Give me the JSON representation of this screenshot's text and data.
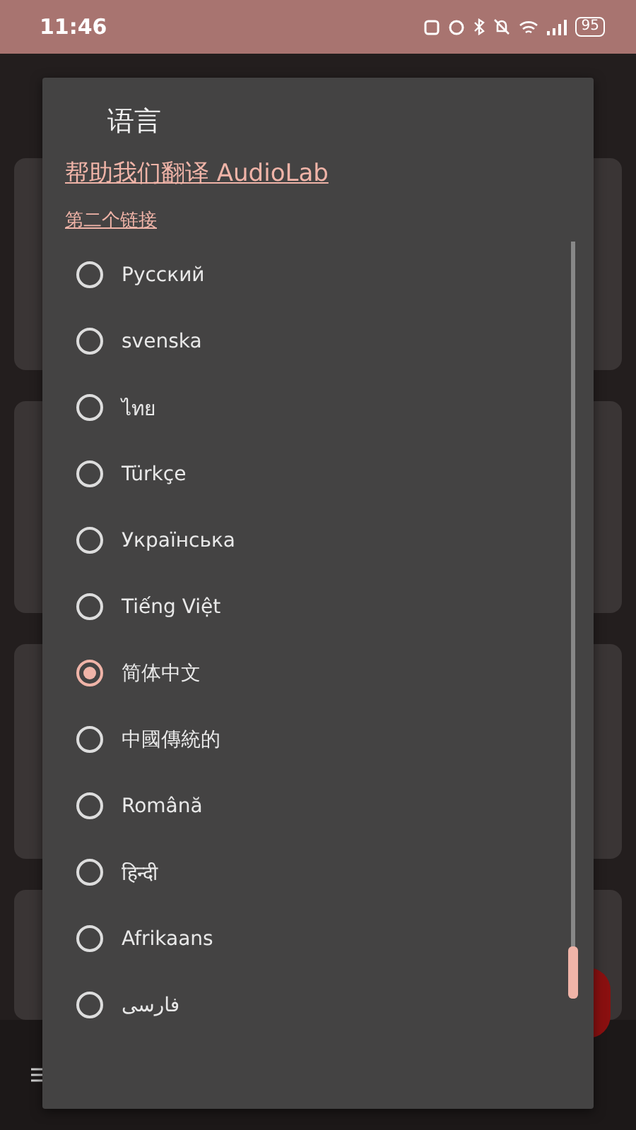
{
  "status_bar": {
    "time": "11:46",
    "battery": "95"
  },
  "dialog": {
    "title": "语言",
    "links": [
      "帮助我们翻译 AudioLab",
      "第二个链接"
    ],
    "options": [
      {
        "label": "Русский",
        "selected": false
      },
      {
        "label": "svenska",
        "selected": false
      },
      {
        "label": "ไทย",
        "selected": false
      },
      {
        "label": "Türkçe",
        "selected": false
      },
      {
        "label": "Українська",
        "selected": false
      },
      {
        "label": "Tiếng Việt",
        "selected": false
      },
      {
        "label": "简体中文",
        "selected": true
      },
      {
        "label": "中國傳統的",
        "selected": false
      },
      {
        "label": "Română",
        "selected": false
      },
      {
        "label": "हिन्दी",
        "selected": false
      },
      {
        "label": "Afrikaans",
        "selected": false
      },
      {
        "label": "فارسی",
        "selected": false
      }
    ]
  }
}
